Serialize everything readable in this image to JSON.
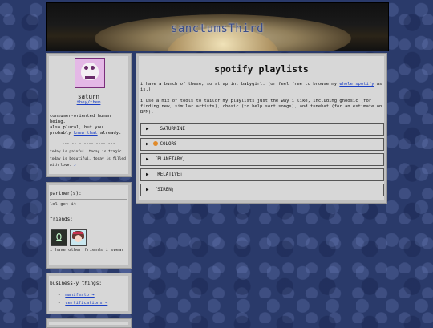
{
  "banner": {
    "title": "sanctumsThird"
  },
  "profile": {
    "name": "saturn",
    "pronouns": "they/them",
    "bio_line1": "consumer-oriented human being.",
    "bio_line2": "also plural, but you",
    "bio_line3_pre": "probably ",
    "bio_line3_link": "knew that",
    "bio_line3_post": " already.",
    "divider": "--- -- - ---- ---- ---",
    "note": "today is painful. today is tragic. today is beautiful. today is filled with love.",
    "note_link": "↗"
  },
  "friends_panel": {
    "partners_heading": "partner(s):",
    "partner_text": "lol get it",
    "friends_heading": "friends:",
    "other_friends": "i have other friends i swear"
  },
  "business": {
    "heading": "business-y things:",
    "items": [
      {
        "label": "manifesto ➜"
      },
      {
        "label": "certifications ➜"
      }
    ]
  },
  "main": {
    "title": "spotify playlists",
    "p1_pre": "i have a bunch of these, so strap in, babygirl. (or feel free to browse my ",
    "p1_link": "whole spotify",
    "p1_post": " as is.)",
    "p2": "i use a mix of tools to tailor my playlists just the way i like, including gnoosic (for finding new, similar artists), chosic (to help sort songs), and tunebat (for an estimate on BPM).",
    "accordions": [
      {
        "label": "SATURNINE",
        "icon_color": "#d7d7d7"
      },
      {
        "label": "COLORS",
        "icon_color": "#e08a2a"
      },
      {
        "label": "「PLANETARY」",
        "icon_color": ""
      },
      {
        "label": "「RELATIVE」",
        "icon_color": ""
      },
      {
        "label": "「SIREN」",
        "icon_color": ""
      }
    ],
    "triangle": "▶"
  }
}
